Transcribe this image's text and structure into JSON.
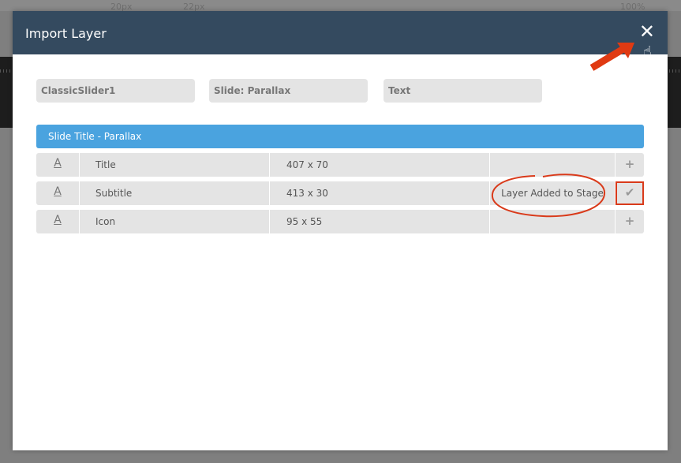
{
  "background_toolbar": {
    "font_size_1": "20px",
    "font_size_2": "22px",
    "zoom": "100%"
  },
  "modal": {
    "title": "Import Layer",
    "close_icon": "close-icon"
  },
  "filters": [
    "ClassicSlider1",
    "Slide: Parallax",
    "Text"
  ],
  "group": {
    "title": "Slide Title - Parallax"
  },
  "layers": [
    {
      "icon": "A",
      "name": "Title",
      "size": "407 x 70",
      "status": "",
      "action": "+"
    },
    {
      "icon": "A",
      "name": "Subtitle",
      "size": "413 x 30",
      "status": "Layer Added to Stage",
      "action": "✔"
    },
    {
      "icon": "A",
      "name": "Icon",
      "size": "95 x 55",
      "status": "",
      "action": "+"
    }
  ],
  "colors": {
    "header": "#344a5f",
    "accent": "#4aa3df",
    "annotation": "#d93a1a"
  }
}
